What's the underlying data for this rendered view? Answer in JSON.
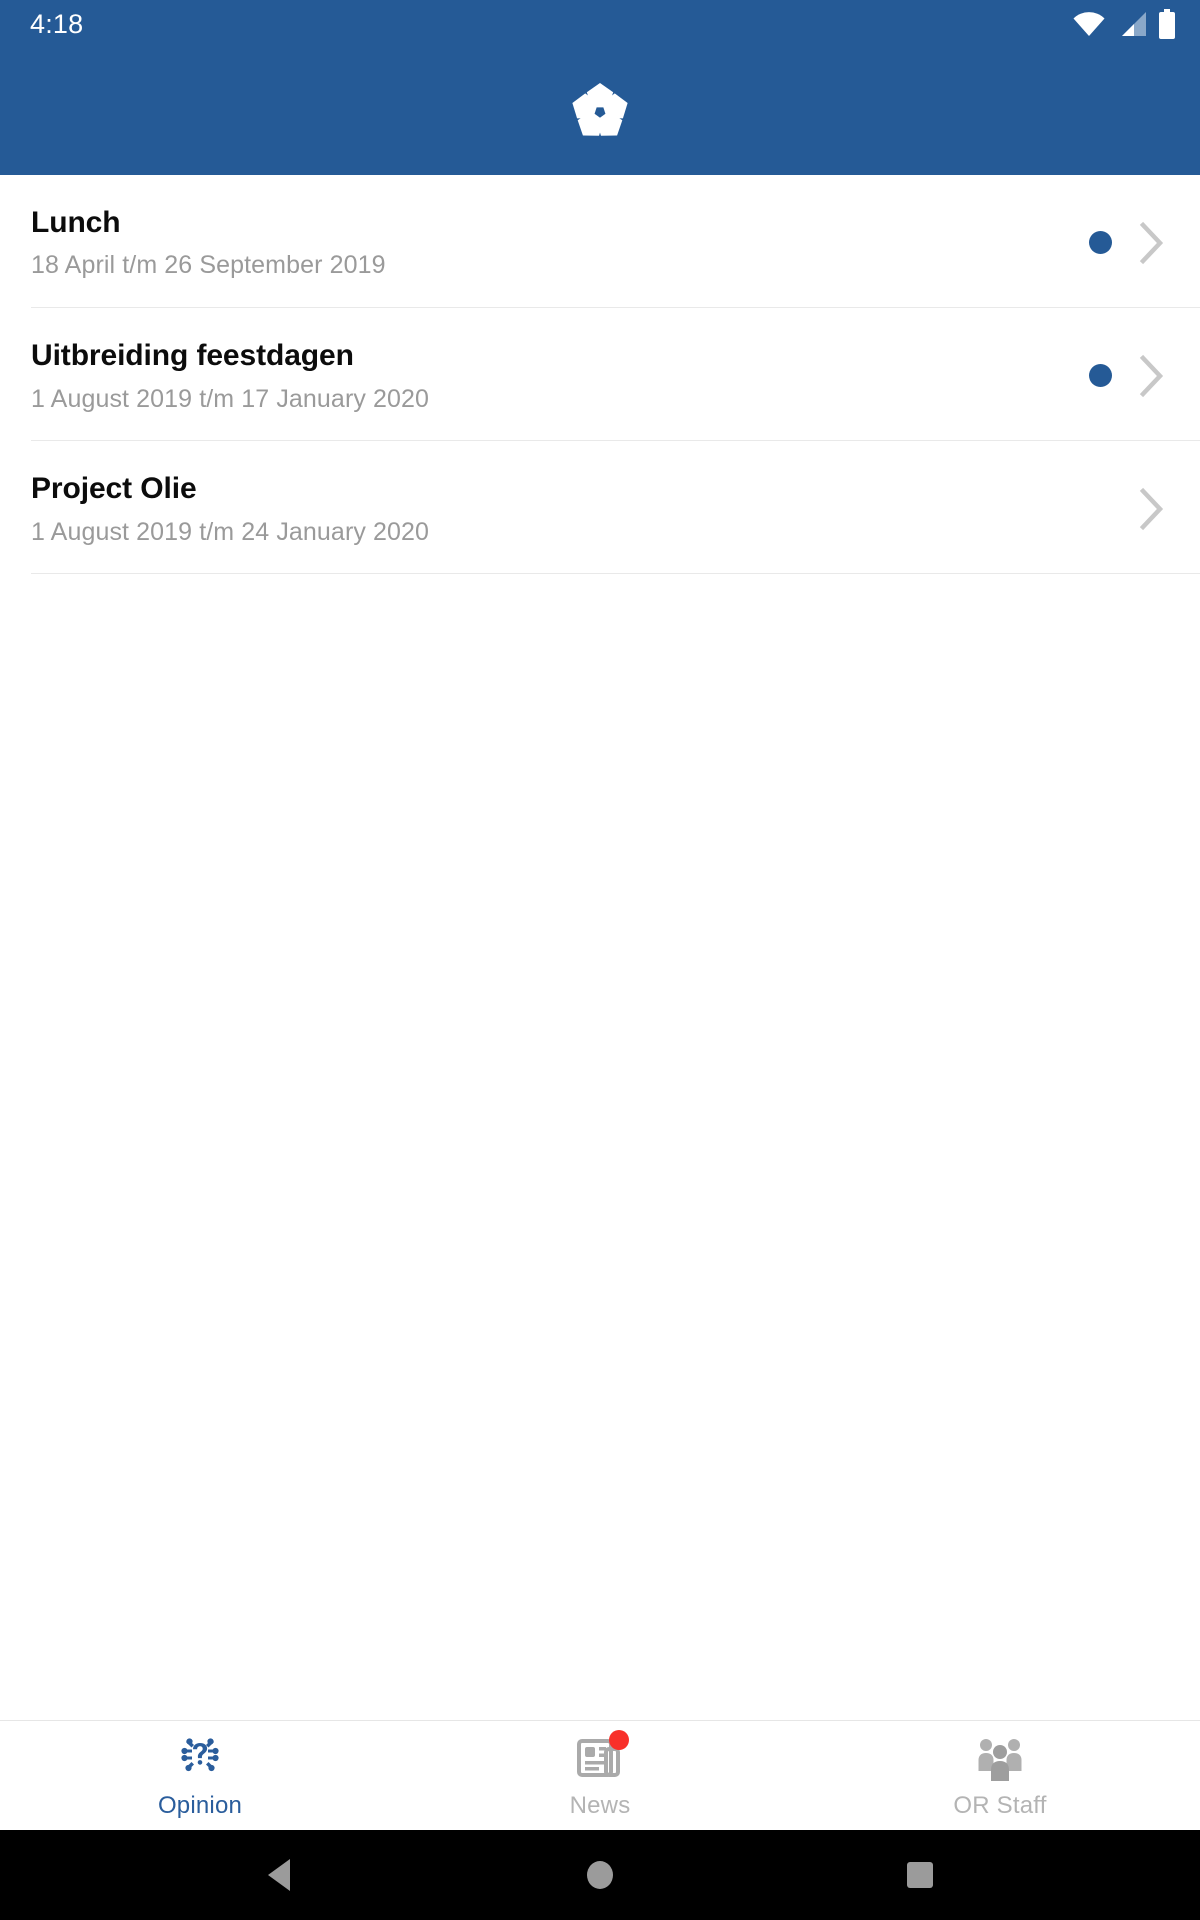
{
  "status_bar": {
    "time": "4:18",
    "icons": [
      "wifi-icon",
      "cellular-signal-icon",
      "battery-icon"
    ]
  },
  "app_bar": {
    "logo_name": "app-logo-pinwheel"
  },
  "colors": {
    "brand_blue": "#255a96",
    "unread_dot": "#255a96",
    "badge_red": "#f8302a",
    "title_text": "#0c0c0c",
    "subtitle_text": "#9a9a9a",
    "inactive_tab": "#b4b4b4",
    "divider": "#e9e9e9"
  },
  "list": {
    "items": [
      {
        "title": "Lunch",
        "date_range": "18 April t/m 26 September 2019",
        "unread": true
      },
      {
        "title": "Uitbreiding feestdagen",
        "date_range": "1 August 2019 t/m 17 January 2020",
        "unread": true
      },
      {
        "title": "Project Olie",
        "date_range": "1 August 2019 t/m 24 January 2020",
        "unread": false
      }
    ]
  },
  "tab_bar": {
    "tabs": [
      {
        "label": "Opinion",
        "icon": "question-opinion-icon",
        "active": true,
        "badge": false
      },
      {
        "label": "News",
        "icon": "newspaper-icon",
        "active": false,
        "badge": true
      },
      {
        "label": "OR Staff",
        "icon": "people-group-icon",
        "active": false,
        "badge": false
      }
    ]
  },
  "android_nav": {
    "buttons": [
      {
        "name": "back-button",
        "icon": "triangle-back-icon"
      },
      {
        "name": "home-button",
        "icon": "circle-home-icon"
      },
      {
        "name": "recents-button",
        "icon": "square-recents-icon"
      }
    ]
  }
}
